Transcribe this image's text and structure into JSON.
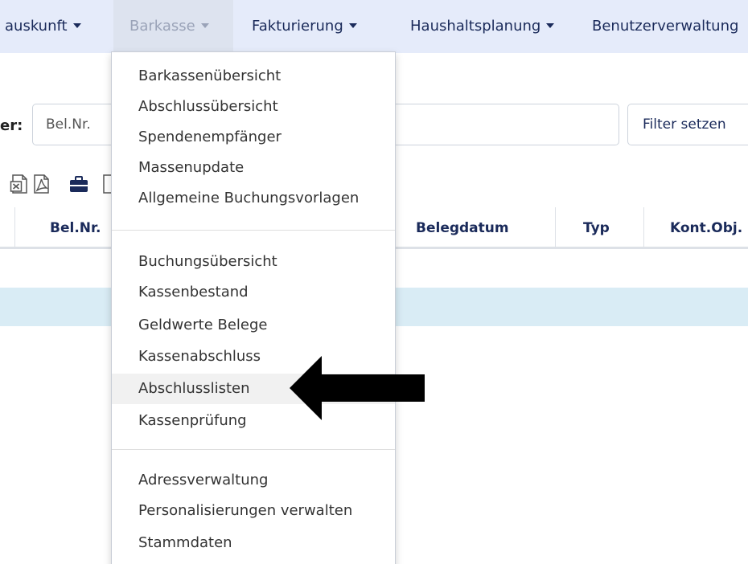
{
  "navbar": {
    "items": [
      {
        "label": "auskunft",
        "active": false
      },
      {
        "label": "Barkasse",
        "active": true
      },
      {
        "label": "Fakturierung",
        "active": false
      },
      {
        "label": "Haushaltsplanung",
        "active": false
      },
      {
        "label": "Benutzerverwaltung",
        "active": false
      }
    ]
  },
  "filter": {
    "label": "er:",
    "placeholder": "Bel.Nr.",
    "button_label": "Filter setzen"
  },
  "toolbar": {
    "icons": [
      "excel-export-icon",
      "pdf-export-icon",
      "briefcase-icon",
      "document-icon"
    ]
  },
  "table": {
    "headers": [
      "Bel.Nr.",
      "Belegdatum",
      "Typ",
      "Kont.Obj."
    ]
  },
  "dropdown": {
    "groups": [
      [
        "Barkassenübersicht",
        "Abschlussübersicht",
        "Spendenempfänger",
        "Massenupdate",
        "Allgemeine Buchungsvorlagen"
      ],
      [
        "Buchungsübersicht",
        "Kassenbestand",
        "Geldwerte Belege",
        "Kassenabschluss",
        "Abschlusslisten",
        "Kassenprüfung"
      ],
      [
        "Adressverwaltung",
        "Personalisierungen verwalten",
        "Stammdaten"
      ]
    ],
    "highlighted_item": "Abschlusslisten"
  },
  "colors": {
    "navbar_bg": "#e5ebfa",
    "nav_text": "#1a2a5a",
    "nav_active_text": "#9aa3b8",
    "info_row_bg": "#d9ecf5",
    "arrow": "#000000"
  }
}
